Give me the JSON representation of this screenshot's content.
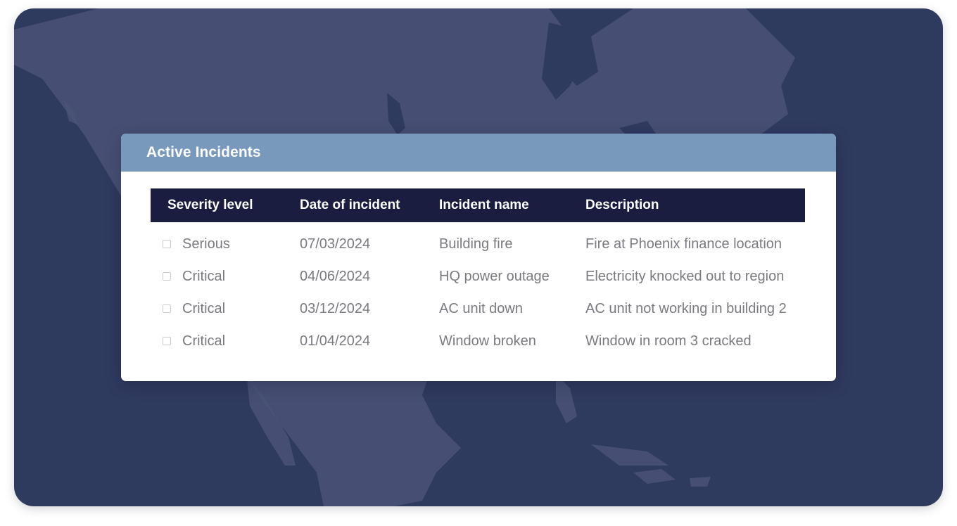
{
  "panel": {
    "title": "Active Incidents"
  },
  "table": {
    "headers": [
      "Severity level",
      "Date of incident",
      "Incident name",
      "Description"
    ],
    "rows": [
      {
        "severity": "Serious",
        "date": "07/03/2024",
        "name": "Building fire",
        "description": "Fire at Phoenix finance location"
      },
      {
        "severity": "Critical",
        "date": "04/06/2024",
        "name": "HQ power outage",
        "description": "Electricity knocked out to region"
      },
      {
        "severity": "Critical",
        "date": "03/12/2024",
        "name": "AC unit down",
        "description": "AC unit not working in building 2"
      },
      {
        "severity": "Critical",
        "date": "01/04/2024",
        "name": "Window broken",
        "description": "Window in room 3 cracked"
      }
    ]
  },
  "colors": {
    "map_ocean": "#2f3a5f",
    "map_land": "#4a5377",
    "header_bar": "#7899bc",
    "table_header": "#1a1c40",
    "cell_text": "#7a7a80"
  }
}
